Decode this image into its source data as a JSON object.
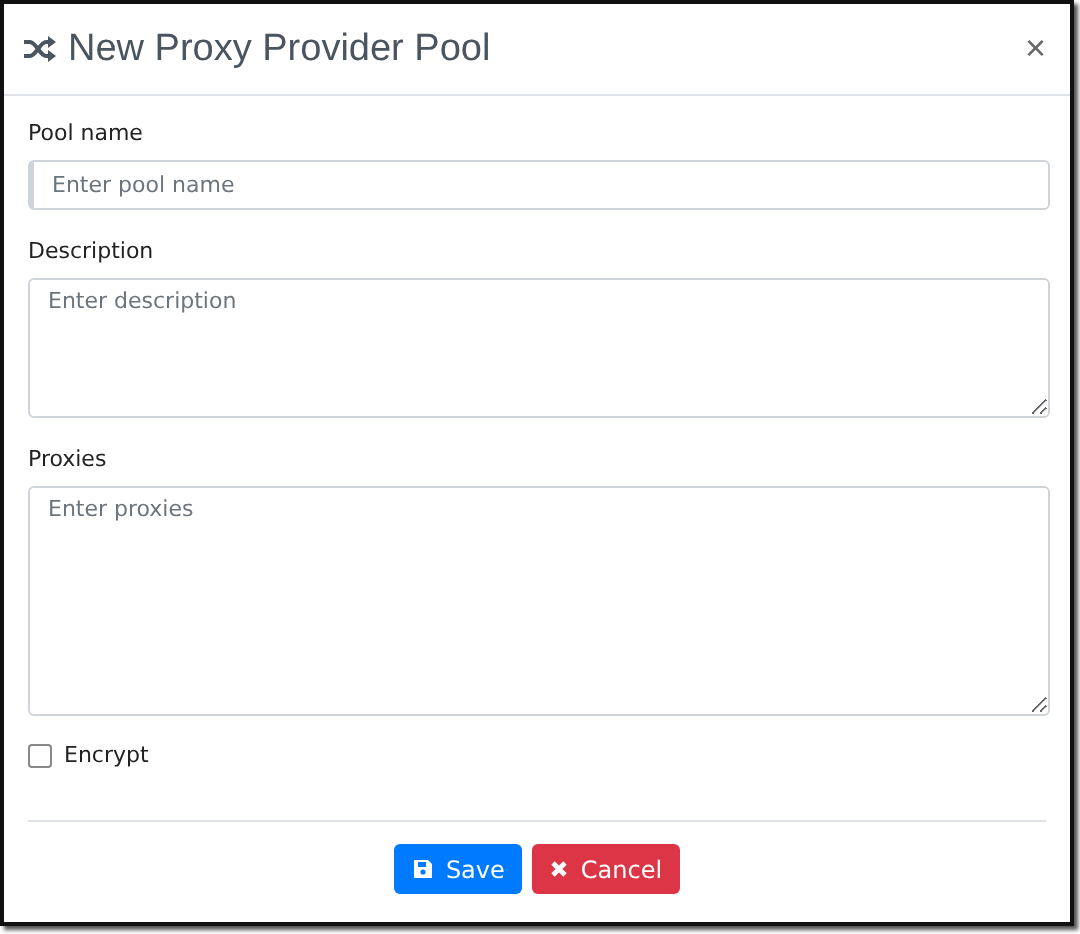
{
  "dialog": {
    "title": "New Proxy Provider Pool",
    "close": "×"
  },
  "fields": [
    {
      "kind": "input",
      "label": "Pool name",
      "placeholder": "Enter pool name"
    },
    {
      "kind": "textarea",
      "label": "Description",
      "placeholder": "Enter description"
    },
    {
      "kind": "tallarea",
      "label": "Proxies",
      "placeholder": "Enter proxies"
    }
  ],
  "encrypt": {
    "label": "Encrypt",
    "checked": false
  },
  "buttons": [
    {
      "kind": "primary",
      "label": "Save"
    },
    {
      "kind": "danger",
      "label": "Cancel"
    }
  ]
}
